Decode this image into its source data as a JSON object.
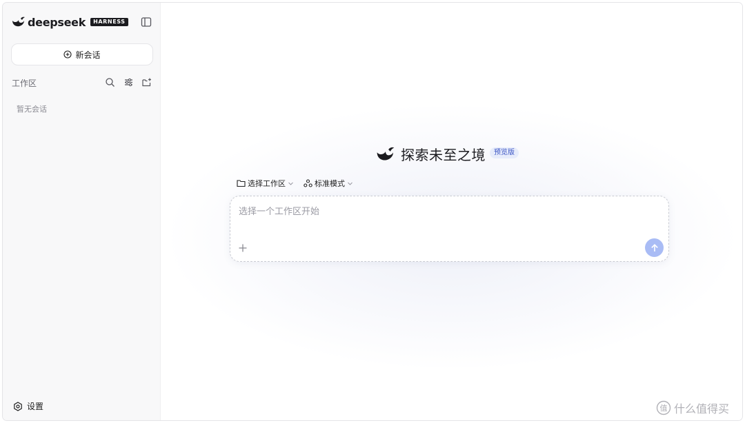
{
  "brand": {
    "name": "deepseek",
    "badge": "HARNESS"
  },
  "sidebar": {
    "new_chat_label": "新会话",
    "workspace_title": "工作区",
    "empty_text": "暂无会话",
    "settings_label": "设置",
    "icons": [
      "search-icon",
      "filter-icon",
      "new-folder-icon",
      "sidebar-toggle-icon"
    ]
  },
  "main": {
    "hero_title": "探索未至之境",
    "preview_badge": "预览版",
    "toolbar": {
      "workspace_select": "选择工作区",
      "mode_select": "标准模式"
    },
    "composer": {
      "placeholder": "选择一个工作区开始",
      "value": ""
    }
  },
  "watermark": {
    "text": "什么值得买"
  },
  "colors": {
    "accent": "#a9bcf5",
    "badge_bg": "#e7ecfb",
    "badge_text": "#3b55c4",
    "sidebar_bg": "#f8f8f9"
  }
}
